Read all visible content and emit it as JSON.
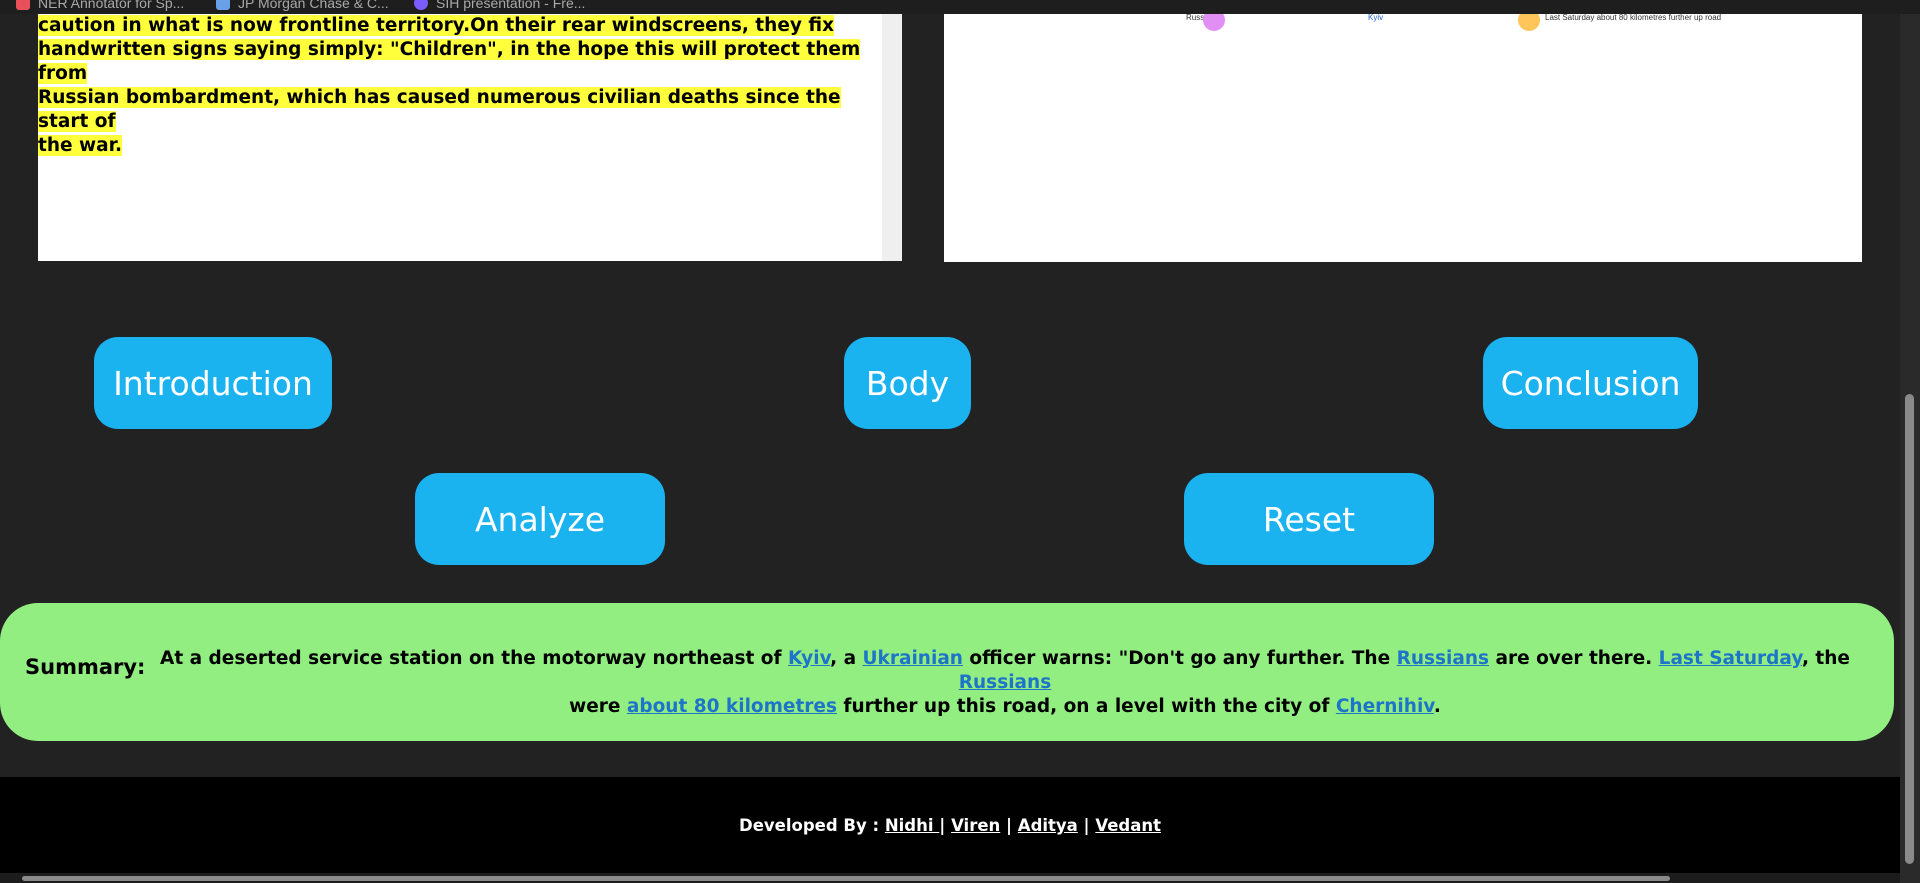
{
  "bookmarks": [
    {
      "label": "NER Annotator for Sp...",
      "icon": "annotator-icon"
    },
    {
      "label": "JP Morgan Chase & C...",
      "icon": "bank-icon"
    },
    {
      "label": "SIH presentation - Fre...",
      "icon": "presentation-icon"
    }
  ],
  "article": {
    "line1": "caution in what is now frontline territory.On their rear windscreens, they fix",
    "line2": "handwritten signs saying simply: \"Children\", in the hope this will protect them from",
    "line3": "Russian bombardment, which has caused numerous civilian deaths since the start of",
    "line4": "the war.",
    "highlight_color": "#ffff3b"
  },
  "graph": {
    "labels": [
      "Russians",
      "Kyiv",
      "Last Saturday about 80 kilometres further up road"
    ],
    "node_colors": [
      "#e18ef5",
      "#ffc55a"
    ]
  },
  "buttons": {
    "introduction": "Introduction",
    "body": "Body",
    "conclusion": "Conclusion",
    "analyze": "Analyze",
    "reset": "Reset",
    "color": "#1ab2ef"
  },
  "summary": {
    "label": "Summary:",
    "t1": "At a deserted service station on the motorway northeast of ",
    "e1": "Kyiv",
    "t2": ", a ",
    "e2": "Ukrainian",
    "t3": " officer warns: \"Don't go any further. The ",
    "e3": "Russians",
    "t4": " are over there. ",
    "e4": "Last Saturday",
    "t5": ", the ",
    "e5": "Russians",
    "t6": " were ",
    "e6": "about 80 kilometres",
    "t7": " further up this road, on a level with the city of ",
    "e7": "Chernihiv",
    "t8": ".",
    "background": "#92ee80"
  },
  "footer": {
    "prefix": "Developed By : ",
    "names": [
      "Nidhi ",
      "Viren",
      "Aditya",
      "Vedant"
    ],
    "sep": " | "
  }
}
